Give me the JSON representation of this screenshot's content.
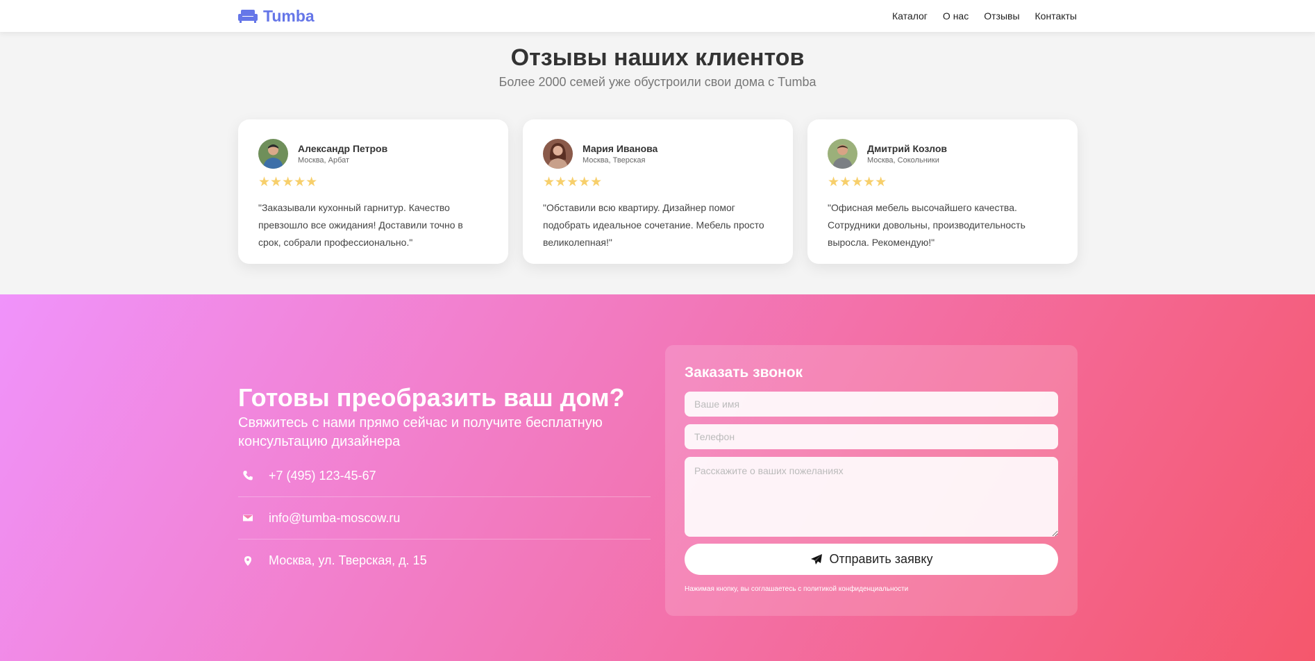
{
  "nav": {
    "brand": "Tumba",
    "links": [
      "Каталог",
      "О нас",
      "Отзывы",
      "Контакты"
    ]
  },
  "reviews": {
    "title": "Отзывы наших клиентов",
    "subtitle": "Более 2000 семей уже обустроили свои дома с Tumba",
    "items": [
      {
        "name": "Александр Петров",
        "location": "Москва, Арбат",
        "stars": "★★★★★",
        "text": "\"Заказывали кухонный гарнитур. Качество превзошло все ожидания! Доставили точно в срок, собрали профессионально.\""
      },
      {
        "name": "Мария Иванова",
        "location": "Москва, Тверская",
        "stars": "★★★★★",
        "text": "\"Обставили всю квартиру. Дизайнер помог подобрать идеальное сочетание. Мебель просто великолепная!\""
      },
      {
        "name": "Дмитрий Козлов",
        "location": "Москва, Сокольники",
        "stars": "★★★★★",
        "text": "\"Офисная мебель высочайшего качества. Сотрудники довольны, производительность выросла. Рекомендую!\""
      }
    ]
  },
  "cta": {
    "title": "Готовы преобразить ваш дом?",
    "subtitle": "Свяжитесь с нами прямо сейчас и получите бесплатную консультацию дизайнера",
    "phone": "+7 (495) 123-45-67",
    "email": "info@tumba-moscow.ru",
    "address": "Москва, ул. Тверская, д. 15"
  },
  "form": {
    "title": "Заказать звонок",
    "name_placeholder": "Ваше имя",
    "phone_placeholder": "Телефон",
    "message_placeholder": "Расскажите о ваших пожеланиях",
    "submit_label": "Отправить заявку",
    "policy": "Нажимая кнопку, вы соглашаетесь с политикой конфиденциальности"
  },
  "colors": {
    "brand": "#6576e8",
    "star": "#f7cf6b",
    "gradient_start": "#f093fb",
    "gradient_end": "#f5576c"
  }
}
